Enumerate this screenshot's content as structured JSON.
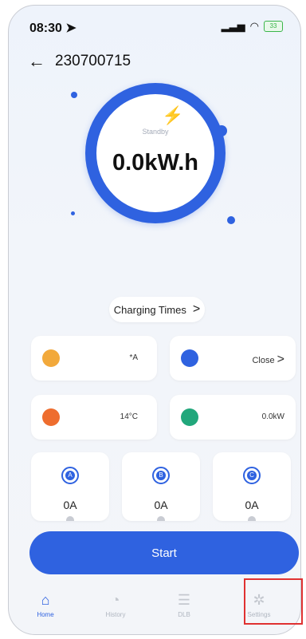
{
  "status": {
    "time": "08:30",
    "battery": "33"
  },
  "header": {
    "title": "230700715"
  },
  "dial": {
    "status": "Standby",
    "energy": "0.0kW.h"
  },
  "charging_times": {
    "label": "Charging Times"
  },
  "cards": {
    "current": {
      "value": "*A"
    },
    "cable": {
      "value": "Close"
    },
    "temperature": {
      "value": "14°C"
    },
    "power": {
      "value": "0.0kW"
    }
  },
  "phases": [
    {
      "id": "A",
      "value": "0A"
    },
    {
      "id": "B",
      "value": "0A"
    },
    {
      "id": "C",
      "value": "0A"
    }
  ],
  "start_button": {
    "label": "Start"
  },
  "tabs": [
    {
      "label": "Home",
      "icon": "home-icon",
      "active": true
    },
    {
      "label": "History",
      "icon": "pie-chart-icon"
    },
    {
      "label": "DLB",
      "icon": "server-icon"
    },
    {
      "label": "Settings",
      "icon": "gear-icon"
    }
  ],
  "colors": {
    "primary": "#2f62e0",
    "highlight": "#e03131"
  }
}
